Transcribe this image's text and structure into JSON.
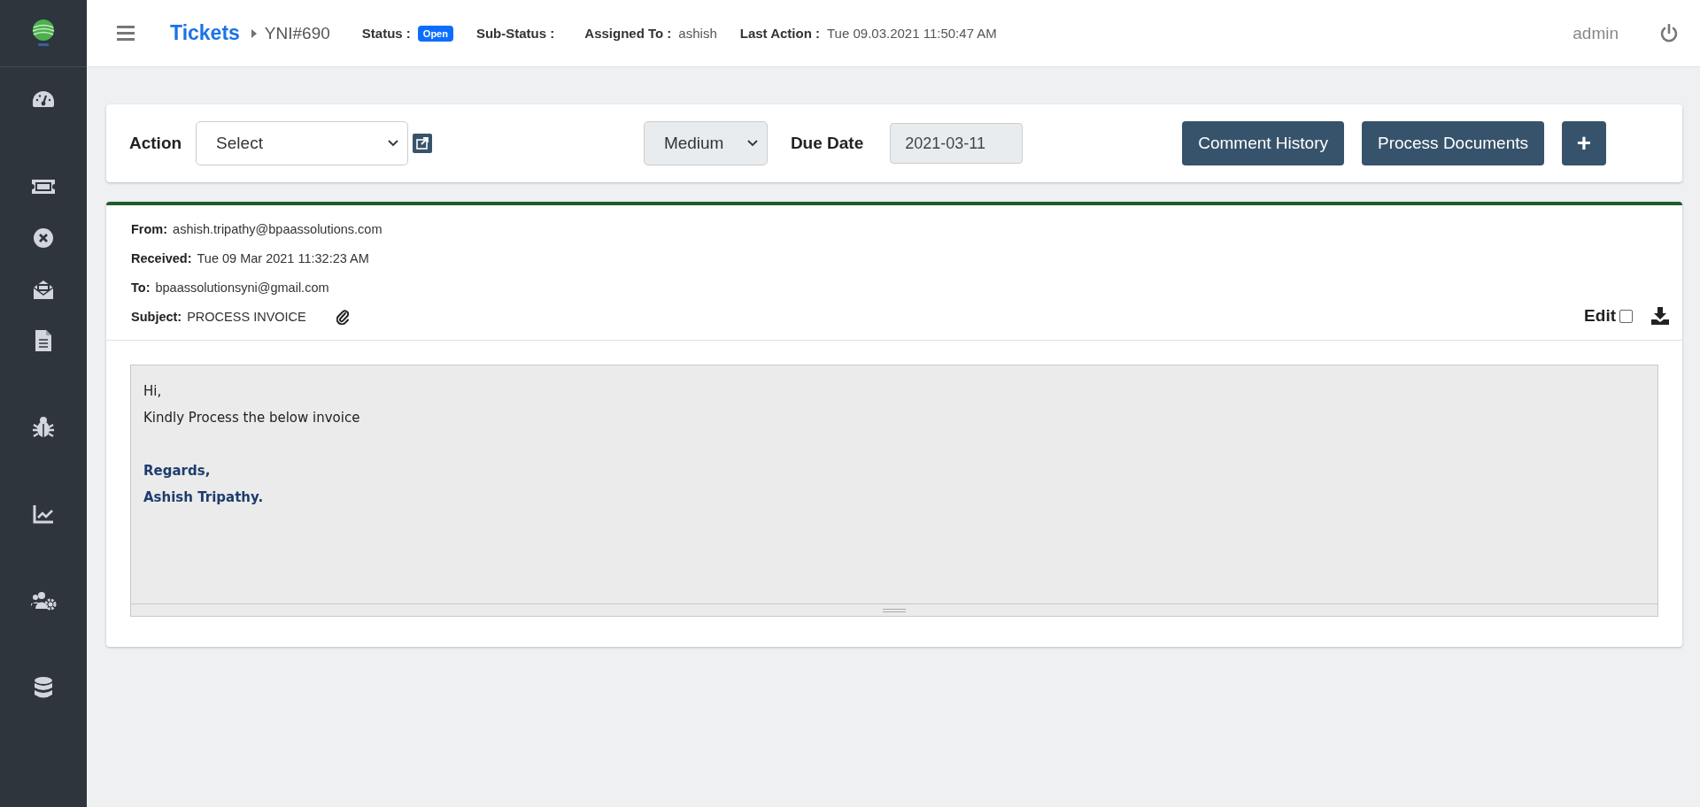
{
  "sidebar": {
    "sections": [
      {
        "items": [
          {
            "kind": "dashboard"
          }
        ]
      },
      {
        "items": [
          {
            "kind": "ticket"
          },
          {
            "kind": "close"
          },
          {
            "kind": "mail"
          },
          {
            "kind": "document"
          }
        ]
      },
      {
        "items": [
          {
            "kind": "bug"
          }
        ]
      },
      {
        "items": [
          {
            "kind": "chart"
          }
        ]
      },
      {
        "items": [
          {
            "kind": "users-gear"
          }
        ]
      },
      {
        "items": [
          {
            "kind": "database"
          }
        ]
      }
    ]
  },
  "header": {
    "title": "Tickets",
    "ticket_id": "YNI#690",
    "fields": [
      {
        "label": "Status :",
        "value": "Open",
        "kind": "badge",
        "color": "#0d6efd"
      },
      {
        "label": "Sub-Status :",
        "kind": "text"
      },
      {
        "label": "Assigned To :",
        "value": "ashish",
        "kind": "text"
      },
      {
        "label": "Last Action :",
        "value": "Tue 09.03.2021 11:50:47 AM",
        "kind": "text"
      }
    ],
    "user": "admin"
  },
  "action_bar": {
    "action_label": "Action",
    "action_value": "Select",
    "priority": "Medium",
    "due_date_label": "Due Date",
    "due_date": "2021-03-11",
    "buttons": [
      {
        "label": "Comment History",
        "kind": "text"
      },
      {
        "label": "Process Documents",
        "kind": "text"
      },
      {
        "label": "+",
        "kind": "icon"
      }
    ]
  },
  "email": {
    "fields": [
      {
        "label": "From:",
        "value": "ashish.tripathy@bpaassolutions.com"
      },
      {
        "label": "Received:",
        "value": "Tue 09 Mar 2021 11:32:23 AM"
      },
      {
        "label": "To:",
        "value": "bpaassolutionsyni@gmail.com"
      },
      {
        "label": "Subject:",
        "value": "PROCESS INVOICE",
        "attachment": true
      }
    ],
    "edit_label": "Edit",
    "edit_checked": false,
    "body": [
      {
        "kind": "text",
        "lines": [
          "Hi,",
          "Kindly Process the below invoice"
        ]
      },
      {
        "kind": "signature",
        "lines": [
          "Regards,",
          "Ashish Tripathy."
        ]
      }
    ]
  }
}
